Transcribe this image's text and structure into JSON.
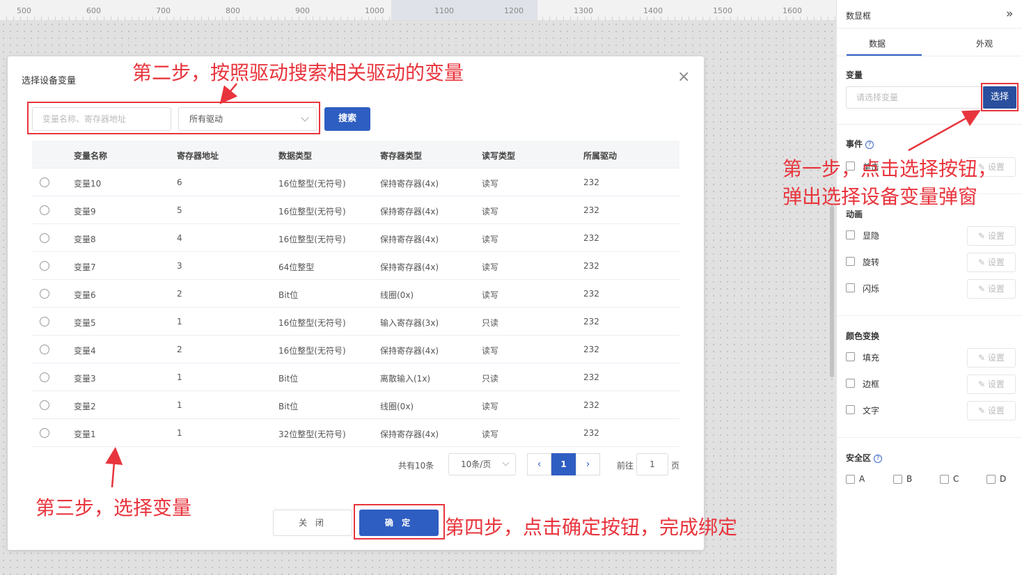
{
  "ruler": {
    "ticks": [
      "500",
      "600",
      "700",
      "800",
      "900",
      "1000",
      "1100",
      "1200",
      "1300",
      "1400",
      "1500",
      "1600"
    ]
  },
  "panel": {
    "title": "数显框",
    "collapse_icon": "»",
    "tabs": [
      "数据",
      "外观"
    ],
    "variable_label": "变量",
    "variable_placeholder": "请选择变量",
    "select_label": "选择",
    "events_label": "事件",
    "events_item": "单击",
    "animation_label": "动画",
    "animation_items": [
      "显隐",
      "旋转",
      "闪烁"
    ],
    "color_label": "颜色变换",
    "color_items": [
      "填充",
      "边框",
      "文字"
    ],
    "set_label": "设置",
    "safe_label": "安全区",
    "safe_items": [
      "A",
      "B",
      "C",
      "D"
    ],
    "help_glyph": "?"
  },
  "dialog": {
    "title": "选择设备变量",
    "close_glyph": "×",
    "search_placeholder": "变量名称、寄存器地址",
    "driver_value": "所有驱动",
    "search_label": "搜索",
    "columns": [
      "变量名称",
      "寄存器地址",
      "数据类型",
      "寄存器类型",
      "读写类型",
      "所属驱动"
    ],
    "rows": [
      [
        "变量10",
        "6",
        "16位整型(无符号)",
        "保持寄存器(4x)",
        "读写",
        "232"
      ],
      [
        "变量9",
        "5",
        "16位整型(无符号)",
        "保持寄存器(4x)",
        "读写",
        "232"
      ],
      [
        "变量8",
        "4",
        "16位整型(无符号)",
        "保持寄存器(4x)",
        "读写",
        "232"
      ],
      [
        "变量7",
        "3",
        "64位整型",
        "保持寄存器(4x)",
        "读写",
        "232"
      ],
      [
        "变量6",
        "2",
        "Bit位",
        "线圈(0x)",
        "读写",
        "232"
      ],
      [
        "变量5",
        "1",
        "16位整型(无符号)",
        "输入寄存器(3x)",
        "只读",
        "232"
      ],
      [
        "变量4",
        "2",
        "16位整型(无符号)",
        "保持寄存器(4x)",
        "读写",
        "232"
      ],
      [
        "变量3",
        "1",
        "Bit位",
        "离散输入(1x)",
        "只读",
        "232"
      ],
      [
        "变量2",
        "1",
        "Bit位",
        "线圈(0x)",
        "读写",
        "232"
      ],
      [
        "变量1",
        "1",
        "32位整型(无符号)",
        "保持寄存器(4x)",
        "读写",
        "232"
      ]
    ],
    "pagination": {
      "total": "共有10条",
      "page_size": "10条/页",
      "prev_glyph": "‹",
      "current_page": "1",
      "next_glyph": "›",
      "goto_label": "前往",
      "goto_value": "1",
      "page_unit": "页"
    },
    "close_label": "关 闭",
    "ok_label": "确 定"
  },
  "annotations": {
    "step1_line1": "第一步，点击选择按钮，",
    "step1_line2": "弹出选择设备变量弹窗",
    "step2": "第二步，按照驱动搜索相关驱动的变量",
    "step3": "第三步，选择变量",
    "step4": "第四步，点击确定按钮，完成绑定"
  },
  "colors": {
    "primary": "#2f5ec2",
    "annotation": "#e8353d",
    "select_button": "#2a4f9e"
  }
}
